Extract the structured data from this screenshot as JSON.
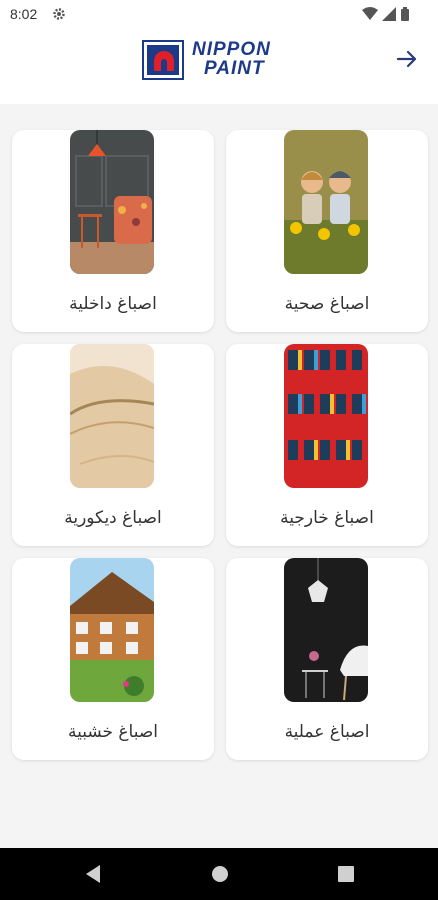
{
  "status_bar": {
    "time": "8:02"
  },
  "header": {
    "logo_line1": "NIPPON",
    "logo_line2": "PAINT",
    "colors": {
      "brand_blue": "#1d3a8a",
      "brand_red": "#e02028"
    }
  },
  "categories": [
    {
      "label": "اصباغ داخلية"
    },
    {
      "label": "اصباغ صحية"
    },
    {
      "label": "اصباغ ديكورية"
    },
    {
      "label": "اصباغ خارجية"
    },
    {
      "label": "اصباغ خشبية"
    },
    {
      "label": "اصباغ عملية"
    }
  ],
  "icons": [
    "gear-icon",
    "wifi-icon",
    "signal-icon",
    "battery-icon",
    "arrow-right-icon",
    "nav-back-icon",
    "nav-home-icon",
    "nav-recents-icon"
  ]
}
